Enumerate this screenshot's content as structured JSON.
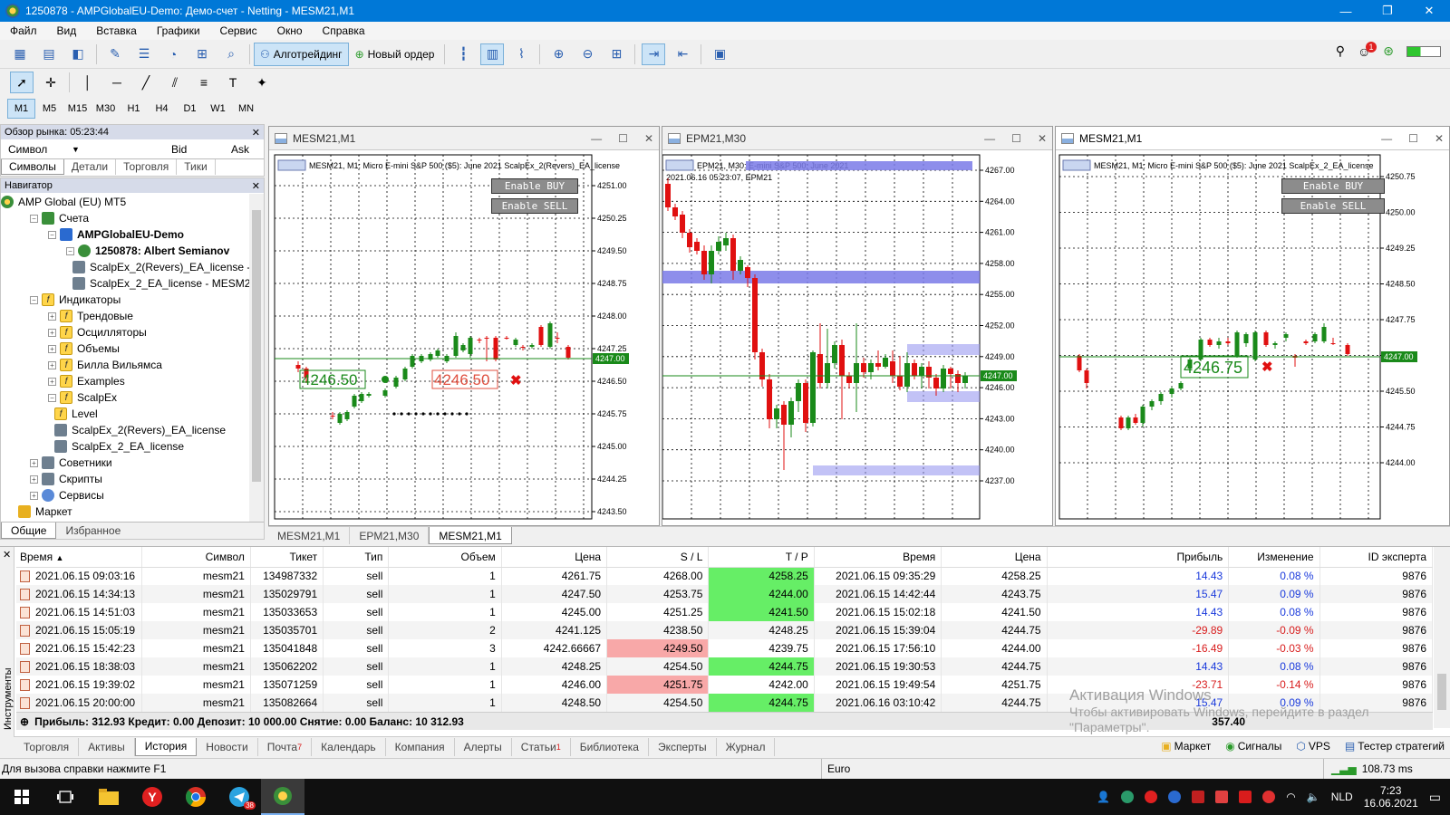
{
  "window": {
    "title": "1250878 - AMPGlobalEU-Demo: Демо-счет - Netting - MESM21,M1",
    "min": "—",
    "max": "❐",
    "close": "✕"
  },
  "menu": [
    "Файл",
    "Вид",
    "Вставка",
    "Графики",
    "Сервис",
    "Окно",
    "Справка"
  ],
  "toolbar": {
    "algotrading": "Алготрейдинг",
    "new_order": "Новый ордер",
    "notif_count": "1"
  },
  "timeframes": [
    "M1",
    "M5",
    "M15",
    "M30",
    "H1",
    "H4",
    "D1",
    "W1",
    "MN"
  ],
  "market_watch": {
    "title": "Обзор рынка: 05:23:44",
    "col_symbol": "Символ",
    "col_bid": "Bid",
    "col_ask": "Ask",
    "tabs": [
      "Символы",
      "Детали",
      "Торговля",
      "Тики"
    ]
  },
  "navigator": {
    "title": "Навигатор",
    "items": [
      {
        "label": "AMP Global (EU) MT5",
        "level": 0,
        "icon": "globe",
        "bold": false,
        "ex": ""
      },
      {
        "label": "Счета",
        "level": 1,
        "icon": "acc",
        "bold": false,
        "ex": "−"
      },
      {
        "label": "AMPGlobalEU-Demo",
        "level": 2,
        "icon": "srv",
        "bold": true,
        "ex": "−"
      },
      {
        "label": "1250878: Albert Semianov",
        "level": 3,
        "icon": "user",
        "bold": true,
        "ex": "−"
      },
      {
        "label": "ScalpEx_2(Revers)_EA_license - ",
        "level": 4,
        "icon": "ea",
        "bold": false,
        "ex": ""
      },
      {
        "label": "ScalpEx_2_EA_license - MESM2",
        "level": 4,
        "icon": "ea",
        "bold": false,
        "ex": ""
      },
      {
        "label": "Индикаторы",
        "level": 1,
        "icon": "fx",
        "bold": false,
        "ex": "−"
      },
      {
        "label": "Трендовые",
        "level": 2,
        "icon": "fx",
        "bold": false,
        "ex": "+"
      },
      {
        "label": "Осцилляторы",
        "level": 2,
        "icon": "fx",
        "bold": false,
        "ex": "+"
      },
      {
        "label": "Объемы",
        "level": 2,
        "icon": "fx",
        "bold": false,
        "ex": "+"
      },
      {
        "label": "Билла Вильямса",
        "level": 2,
        "icon": "fx",
        "bold": false,
        "ex": "+"
      },
      {
        "label": "Examples",
        "level": 2,
        "icon": "fx",
        "bold": false,
        "ex": "+"
      },
      {
        "label": "ScalpEx",
        "level": 2,
        "icon": "fx",
        "bold": false,
        "ex": "−"
      },
      {
        "label": "Level",
        "level": 3,
        "icon": "fx",
        "bold": false,
        "ex": ""
      },
      {
        "label": "ScalpEx_2(Revers)_EA_license",
        "level": 3,
        "icon": "ea",
        "bold": false,
        "ex": ""
      },
      {
        "label": "ScalpEx_2_EA_license",
        "level": 3,
        "icon": "ea",
        "bold": false,
        "ex": ""
      },
      {
        "label": "Советники",
        "level": 1,
        "icon": "ea",
        "bold": false,
        "ex": "+"
      },
      {
        "label": "Скрипты",
        "level": 1,
        "icon": "ea",
        "bold": false,
        "ex": "+"
      },
      {
        "label": "Сервисы",
        "level": 1,
        "icon": "gear",
        "bold": false,
        "ex": "+"
      },
      {
        "label": "Маркет",
        "level": 1,
        "icon": "bag",
        "bold": false,
        "ex": ""
      }
    ],
    "tabs": [
      "Общие",
      "Избранное"
    ]
  },
  "charts": [
    {
      "id": "c1",
      "title": "MESM21,M1",
      "info": "MESM21, M1:  Micro E-mini S&P 500 ($5): June 2021   ScalpEx_2(Revers)_EA_license",
      "prices": [
        "4251.00",
        "4250.25",
        "4249.50",
        "4248.75",
        "4248.00",
        "4247.25",
        "4246.50",
        "4245.75",
        "4245.00",
        "4244.25",
        "4243.50"
      ],
      "last": "4247.00",
      "level_left": "4246.50",
      "level_right": "4246.50",
      "buy": "Enable BUY",
      "sell": "Enable SELL"
    },
    {
      "id": "c2",
      "title": "EPM21,M30",
      "info": "EPM21, M30:  E-mini S&P 500: June 2021",
      "sub": "2021.06.16 05:23:07, EPM21",
      "prices": [
        "4267.00",
        "4264.00",
        "4261.00",
        "4258.00",
        "4255.00",
        "4252.00",
        "4249.00",
        "4246.00",
        "4243.00",
        "4240.00",
        "4237.00"
      ],
      "last": "4247.00"
    },
    {
      "id": "c3",
      "title": "MESM21,M1",
      "info": "MESM21, M1:  Micro E-mini S&P 500 ($5): June 2021   ScalpEx_2_EA_license",
      "prices": [
        "4250.75",
        "4250.00",
        "4249.25",
        "4248.50",
        "4247.75",
        "4246.25",
        "4245.50",
        "4244.75",
        "4244.00"
      ],
      "last": "4247.00",
      "level_left": "4246.75",
      "buy": "Enable BUY",
      "sell": "Enable SELL"
    }
  ],
  "chart_tabs": [
    "MESM21,M1",
    "EPM21,M30",
    "MESM21,M1"
  ],
  "history": {
    "headers": [
      "Время",
      "Символ",
      "Тикет",
      "Тип",
      "Объем",
      "Цена",
      "S / L",
      "T / P",
      "Время",
      "Цена",
      "Прибыль",
      "Изменение",
      "ID эксперта"
    ],
    "rows": [
      [
        "2021.06.15 09:03:16",
        "mesm21",
        "134987332",
        "sell",
        "1",
        "4261.75",
        "4268.00",
        "4258.25",
        "2021.06.15 09:35:29",
        "4258.25",
        "14.43",
        "0.08 %",
        "9876"
      ],
      [
        "2021.06.15 14:34:13",
        "mesm21",
        "135029791",
        "sell",
        "1",
        "4247.50",
        "4253.75",
        "4244.00",
        "2021.06.15 14:42:44",
        "4243.75",
        "15.47",
        "0.09 %",
        "9876"
      ],
      [
        "2021.06.15 14:51:03",
        "mesm21",
        "135033653",
        "sell",
        "1",
        "4245.00",
        "4251.25",
        "4241.50",
        "2021.06.15 15:02:18",
        "4241.50",
        "14.43",
        "0.08 %",
        "9876"
      ],
      [
        "2021.06.15 15:05:19",
        "mesm21",
        "135035701",
        "sell",
        "2",
        "4241.125",
        "4238.50",
        "4248.25",
        "2021.06.15 15:39:04",
        "4244.75",
        "-29.89",
        "-0.09 %",
        "9876"
      ],
      [
        "2021.06.15 15:42:23",
        "mesm21",
        "135041848",
        "sell",
        "3",
        "4242.66667",
        "4249.50",
        "4239.75",
        "2021.06.15 17:56:10",
        "4244.00",
        "-16.49",
        "-0.03 %",
        "9876"
      ],
      [
        "2021.06.15 18:38:03",
        "mesm21",
        "135062202",
        "sell",
        "1",
        "4248.25",
        "4254.50",
        "4244.75",
        "2021.06.15 19:30:53",
        "4244.75",
        "14.43",
        "0.08 %",
        "9876"
      ],
      [
        "2021.06.15 19:39:02",
        "mesm21",
        "135071259",
        "sell",
        "1",
        "4246.00",
        "4251.75",
        "4242.00",
        "2021.06.15 19:49:54",
        "4251.75",
        "-23.71",
        "-0.14 %",
        "9876"
      ],
      [
        "2021.06.15 20:00:00",
        "mesm21",
        "135082664",
        "sell",
        "1",
        "4248.50",
        "4254.50",
        "4244.75",
        "2021.06.16 03:10:42",
        "4244.75",
        "15.47",
        "0.09 %",
        "9876"
      ]
    ],
    "summary": "Прибыль: 312.93  Кредит: 0.00  Депозит: 10 000.00  Снятие: 0.00  Баланс: 10 312.93",
    "total": "357.40",
    "side_label": "Инструменты"
  },
  "toolbox_tabs": [
    "Торговля",
    "Активы",
    "История",
    "Новости",
    "Почта",
    "Календарь",
    "Компания",
    "Алерты",
    "Статьи",
    "Библиотека",
    "Эксперты",
    "Журнал"
  ],
  "toolbox_right": [
    "Маркет",
    "Сигналы",
    "VPS",
    "Тестер стратегий"
  ],
  "mail_badge": "7",
  "articles_badge": "1",
  "status": {
    "help": "Для вызова справки нажмите F1",
    "profile": "Euro",
    "ping": "108.73 ms"
  },
  "watermark": {
    "line1": "Активация Windows",
    "line2": "Чтобы активировать Windows, перейдите в раздел",
    "line3": "\"Параметры\"."
  },
  "taskbar": {
    "lang": "NLD",
    "time": "7:23",
    "date": "16.06.2021",
    "badge": "38"
  },
  "colors": {
    "accent": "#0078d7",
    "grid": "#000000",
    "bull": "#1a8a1a",
    "bear": "#e01010",
    "zone": "#7a7ae8"
  }
}
